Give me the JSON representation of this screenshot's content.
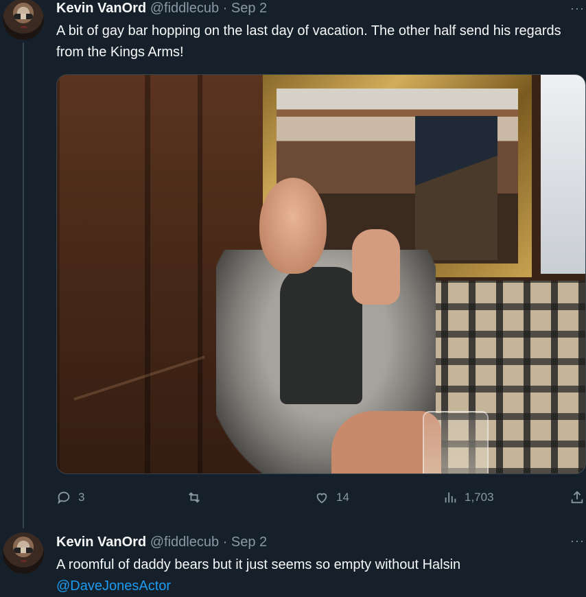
{
  "tweets": [
    {
      "author_name": "Kevin VanOrd",
      "handle": "@fiddlecub",
      "separator": "·",
      "date": "Sep 2",
      "more_label": "···",
      "text": "A bit of gay bar hopping on the last day of vacation. The other half send his regards from the Kings Arms!",
      "stats": {
        "replies": "3",
        "retweets": "",
        "likes": "14",
        "views": "1,703"
      }
    },
    {
      "author_name": "Kevin VanOrd",
      "handle": "@fiddlecub",
      "separator": "·",
      "date": "Sep 2",
      "more_label": "···",
      "text": "A roomful of daddy bears but it just seems so empty without Halsin",
      "mention": "@DaveJonesActor"
    }
  ],
  "icons": {
    "reply": "reply-icon",
    "retweet": "retweet-icon",
    "like": "heart-icon",
    "views": "views-icon",
    "share": "share-icon"
  },
  "colors": {
    "background": "#15202b",
    "text": "#f7f9f9",
    "muted": "#8b98a5",
    "link": "#1d9bf0",
    "divider": "#38444d"
  }
}
